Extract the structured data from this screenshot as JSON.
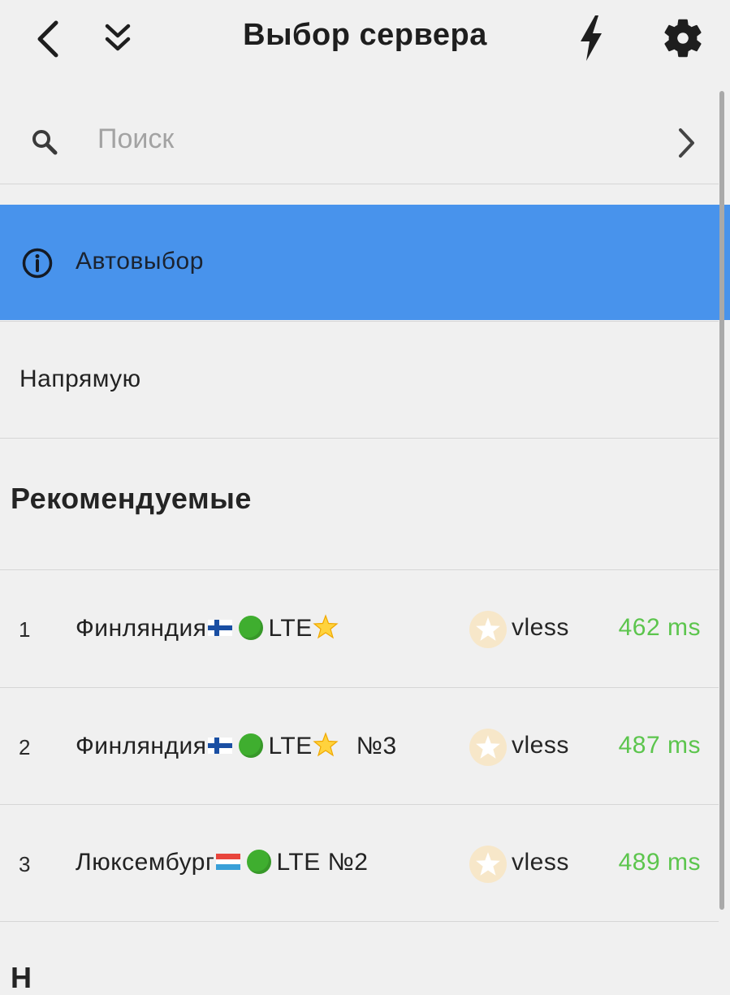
{
  "header": {
    "title": "Выбор сервера",
    "icons": [
      "back-icon",
      "double-chevron-down-icon",
      "lightning-icon",
      "gear-icon"
    ]
  },
  "search": {
    "placeholder": "Поиск"
  },
  "auto_select": {
    "label": "Автовыбор",
    "icon": "info-icon",
    "color": "#4893ec"
  },
  "direct": {
    "label": "Напрямую"
  },
  "recommended": {
    "title": "Рекомендуемые",
    "servers": [
      {
        "number": "1",
        "country": "Финляндия",
        "flag": "fi",
        "name_suffix": "LTE",
        "extra": "",
        "protocol": "vless",
        "ping": "462 ms"
      },
      {
        "number": "2",
        "country": "Финляндия",
        "flag": "fi",
        "name_suffix": "LTE",
        "extra": "№3",
        "protocol": "vless",
        "ping": "487 ms"
      },
      {
        "number": "3",
        "country": "Люксембург",
        "flag": "lu",
        "name_suffix": "LTE №2",
        "extra": "",
        "protocol": "vless",
        "ping": "489 ms"
      }
    ]
  },
  "next_section": {
    "title_partial": "Н"
  },
  "colors": {
    "accent": "#4893ec",
    "ping": "#5cc54d",
    "background": "#f0f0f0"
  }
}
